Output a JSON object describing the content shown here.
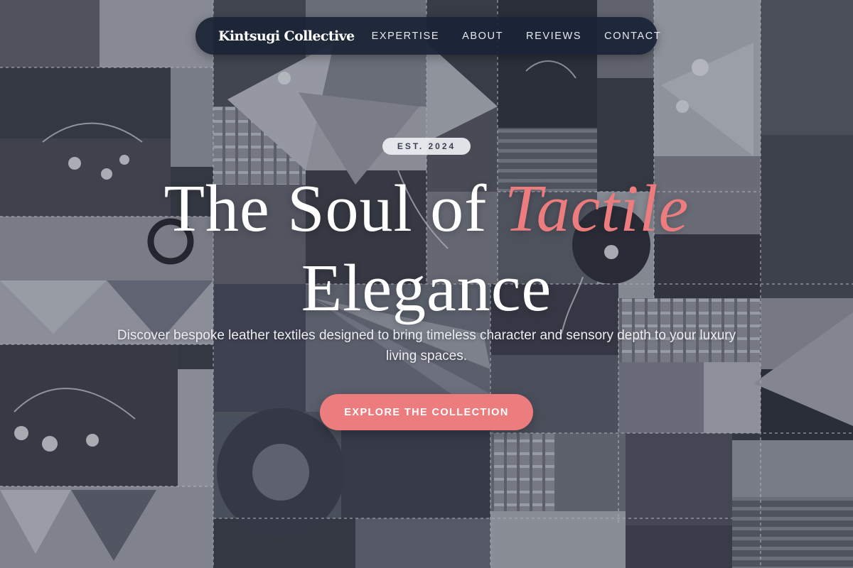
{
  "nav": {
    "brand": "Kintsugi Collective",
    "links": [
      "EXPERTISE",
      "ABOUT",
      "REVIEWS",
      "CONTACT"
    ]
  },
  "hero": {
    "badge": "EST. 2024",
    "headline_part1": "The Soul of ",
    "headline_accent": "Tactile",
    "headline_part2": "Elegance",
    "subtitle": "Discover bespoke leather textiles designed to bring timeless character and sensory depth to your luxury living spaces.",
    "cta_label": "EXPLORE THE COLLECTION"
  },
  "colors": {
    "accent": "#ec7c7e",
    "nav_background": "#1a2336",
    "badge_background": "#eceef2",
    "text": "#ffffff"
  }
}
